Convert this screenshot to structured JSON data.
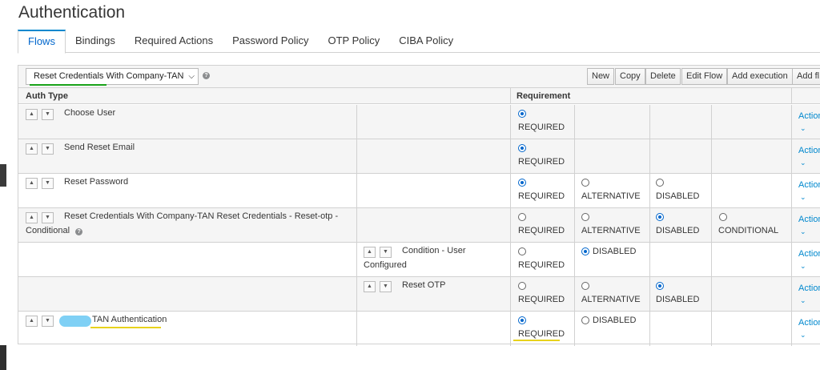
{
  "page_title": "Authentication",
  "tabs": [
    {
      "label": "Flows",
      "active": true
    },
    {
      "label": "Bindings"
    },
    {
      "label": "Required Actions"
    },
    {
      "label": "Password Policy"
    },
    {
      "label": "OTP Policy"
    },
    {
      "label": "CIBA Policy"
    }
  ],
  "toolbar": {
    "flow_select_value": "Reset Credentials With Company-TAN",
    "buttons": [
      "New",
      "Copy",
      "Delete",
      "Edit Flow",
      "Add execution",
      "Add fl"
    ]
  },
  "table": {
    "headers": {
      "auth_type": "Auth Type",
      "requirement": "Requirement"
    },
    "action_label": "Action",
    "rows": [
      {
        "label": "Choose User",
        "options": [
          {
            "label": "REQUIRED",
            "selected": true
          }
        ]
      },
      {
        "label": "Send Reset Email",
        "options": [
          {
            "label": "REQUIRED",
            "selected": true
          }
        ]
      },
      {
        "label": "Reset Password",
        "options": [
          {
            "label": "REQUIRED",
            "selected": true
          },
          {
            "label": "ALTERNATIVE"
          },
          {
            "label": "DISABLED"
          }
        ]
      },
      {
        "label_line1": "Reset Credentials With Company-TAN Reset Credentials - Reset-otp -",
        "label_line2": "Conditional",
        "options": [
          {
            "label": "REQUIRED"
          },
          {
            "label": "ALTERNATIVE"
          },
          {
            "label": "DISABLED",
            "selected": true
          },
          {
            "label": "CONDITIONAL"
          }
        ]
      },
      {
        "label_line1": "Condition - User",
        "label_line2": "Configured",
        "options": [
          {
            "label": "REQUIRED"
          },
          {
            "label": "DISABLED",
            "selected": true
          }
        ]
      },
      {
        "label": "Reset OTP",
        "options": [
          {
            "label": "REQUIRED"
          },
          {
            "label": "ALTERNATIVE"
          },
          {
            "label": "DISABLED",
            "selected": true
          }
        ]
      },
      {
        "label": "TAN Authentication",
        "options": [
          {
            "label": "REQUIRED",
            "selected": true
          },
          {
            "label": "DISABLED"
          }
        ]
      }
    ]
  },
  "colors": {
    "accent": "#0066cc",
    "link": "#0088ce",
    "highlight_green": "#1aa31a",
    "highlight_yellow": "#e8d21c",
    "blur": "#7fd0f5"
  }
}
